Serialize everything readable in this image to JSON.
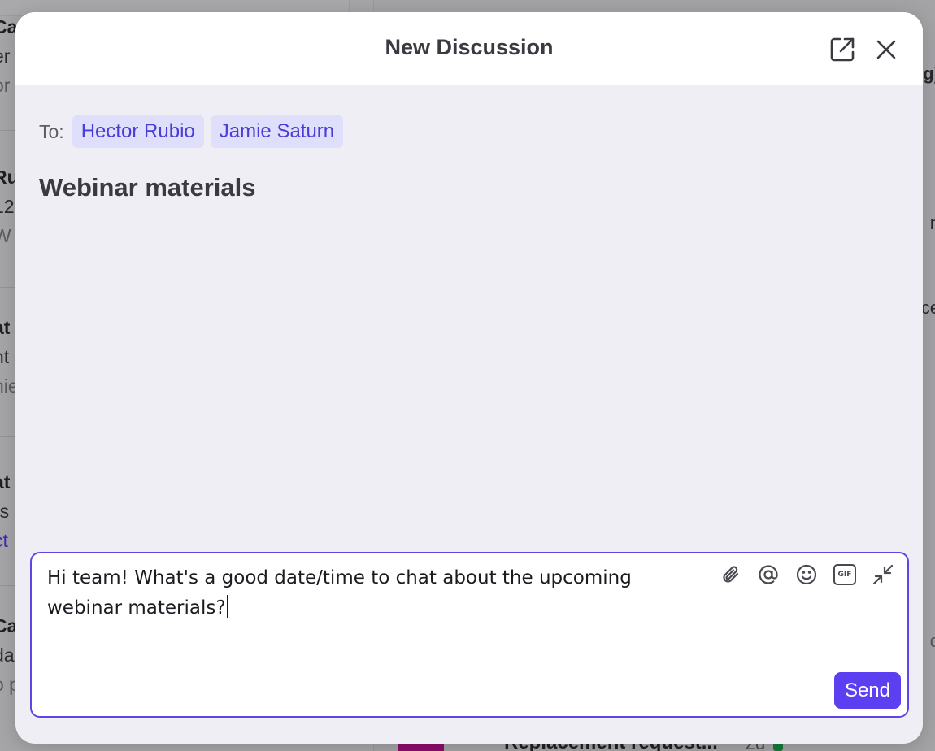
{
  "background": {
    "left_rows": [
      {
        "r1": "Ca",
        "r2": "er",
        "r3": "or",
        "link": false
      },
      {
        "r1": "Ru",
        "r2": "12",
        "r3": "W",
        "link": false
      },
      {
        "r1": "at",
        "r2": "nt",
        "r3": "nie",
        "link": false
      },
      {
        "r1": "at",
        "r2": "rs",
        "r3": "ct",
        "link": true
      },
      {
        "r1": "Ca",
        "r2": "da",
        "r3": "o p",
        "link": false
      }
    ],
    "right_texts": [
      "g)",
      "n",
      "ce",
      "d"
    ],
    "bottom_item": {
      "title": "Replacement request...",
      "age": "2d"
    }
  },
  "modal": {
    "title": "New Discussion",
    "popout_icon": "popout-icon",
    "close_icon": "close-icon",
    "to_label": "To:",
    "recipients": [
      "Hector Rubio",
      "Jamie Saturn"
    ],
    "subject": "Webinar materials",
    "composer": {
      "line1": "Hi team! What's a good date/time to chat about the upcoming",
      "line2": "webinar materials?",
      "toolbar": [
        "attachment-icon",
        "mention-icon",
        "emoji-icon",
        "gif-icon",
        "collapse-icon"
      ],
      "gif_label": "GIF",
      "send_label": "Send"
    },
    "accent_color": "#5b3ff0",
    "chip_text_color": "#4a3cd6"
  }
}
